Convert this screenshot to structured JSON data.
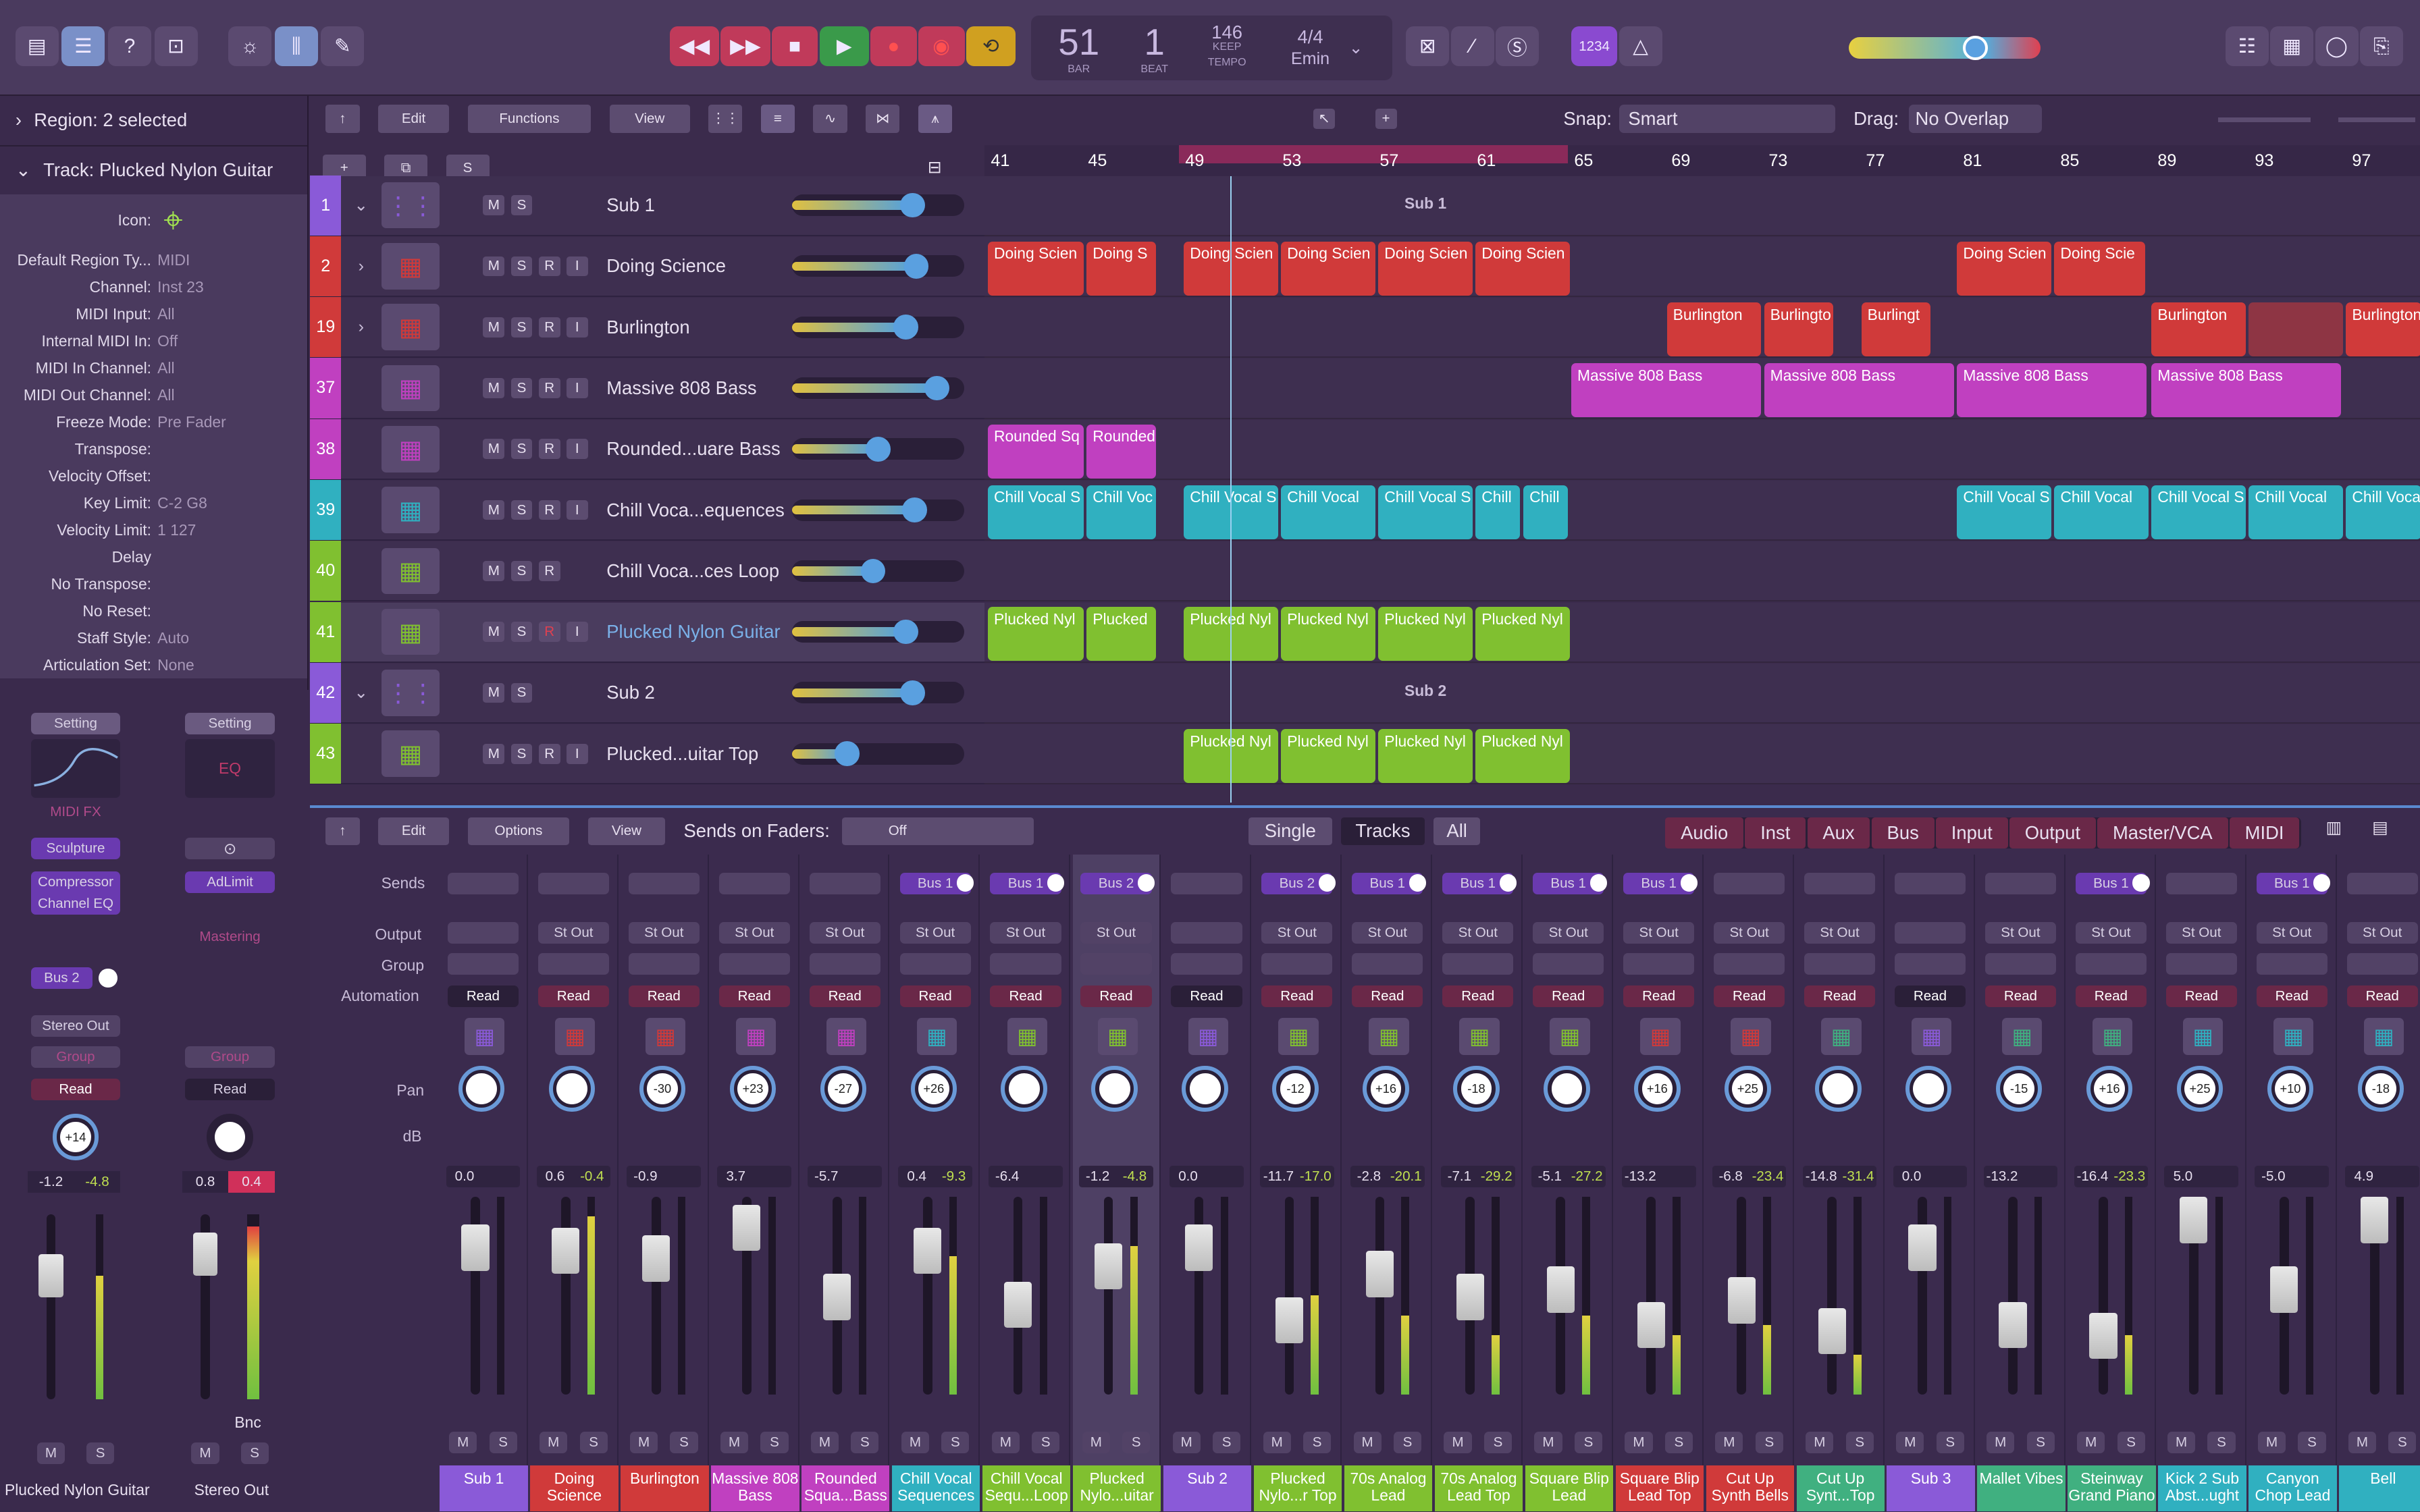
{
  "lcd": {
    "bar": "51",
    "beat": "1",
    "bar_lbl": "BAR",
    "beat_lbl": "BEAT",
    "tempo": "146",
    "keep": "KEEP",
    "tempo_lbl": "TEMPO",
    "sig": "4/4",
    "key": "Emin"
  },
  "countin": "1234",
  "inspector": {
    "region": "Region: 2 selected",
    "track": "Track:  Plucked Nylon Guitar",
    "icon_lbl": "Icon:",
    "rows": [
      [
        "Default Region Ty...",
        "MIDI"
      ],
      [
        "Channel:",
        "Inst 23"
      ],
      [
        "MIDI Input:",
        "All"
      ],
      [
        "Internal MIDI In:",
        "Off"
      ],
      [
        "MIDI In Channel:",
        "All"
      ],
      [
        "MIDI Out Channel:",
        "All"
      ],
      [
        "Freeze Mode:",
        "Pre Fader"
      ],
      [
        "Transpose:",
        ""
      ],
      [
        "Velocity Offset:",
        ""
      ],
      [
        "Key Limit:",
        "C-2  G8"
      ],
      [
        "Velocity Limit:",
        "1  127"
      ],
      [
        "Delay",
        ""
      ],
      [
        "No Transpose:",
        ""
      ],
      [
        "No Reset:",
        ""
      ],
      [
        "Staff Style:",
        "Auto"
      ],
      [
        "Articulation Set:",
        "None"
      ]
    ],
    "s1": {
      "setting": "Setting",
      "midifx": "MIDI FX",
      "inst": "Sculpture",
      "fx1": "Compressor",
      "fx2": "Channel EQ",
      "bus": "Bus 2",
      "out": "Stereo Out",
      "group": "Group",
      "read": "Read",
      "pan": "+14",
      "db1": "-1.2",
      "db2": "-4.8",
      "m": "M",
      "s": "S",
      "name": "Plucked Nylon Guitar"
    },
    "s2": {
      "setting": "Setting",
      "eq": "EQ",
      "fx1": "AdLimit",
      "mastering": "Mastering",
      "group": "Group",
      "read": "Read",
      "db1": "0.8",
      "db2": "0.4",
      "bnc": "Bnc",
      "m": "M",
      "s": "S",
      "name": "Stereo Out"
    }
  },
  "arr_menu": {
    "edit": "Edit",
    "functions": "Functions",
    "view": "View",
    "snap_lbl": "Snap:",
    "snap": "Smart",
    "drag_lbl": "Drag:",
    "drag": "No Overlap",
    "s": "S"
  },
  "ruler": [
    "41",
    "45",
    "49",
    "53",
    "57",
    "61",
    "65",
    "69",
    "73",
    "77",
    "81",
    "85",
    "89",
    "93",
    "97"
  ],
  "tracks": [
    {
      "num": "1",
      "name": "Sub 1",
      "col": "#8a5ad8",
      "fold": true,
      "btns": [
        "M",
        "S"
      ],
      "knob": 0.7,
      "lanelabel": "Sub 1"
    },
    {
      "num": "2",
      "name": "Doing Science",
      "col": "#d03a3a",
      "disc": true,
      "btns": [
        "M",
        "S",
        "R",
        "I"
      ],
      "knob": 0.72
    },
    {
      "num": "19",
      "name": "Burlington",
      "col": "#d03a3a",
      "disc": true,
      "btns": [
        "M",
        "S",
        "R",
        "I"
      ],
      "knob": 0.66
    },
    {
      "num": "37",
      "name": "Massive 808 Bass",
      "col": "#c040c0",
      "btns": [
        "M",
        "S",
        "R",
        "I"
      ],
      "knob": 0.84
    },
    {
      "num": "38",
      "name": "Rounded...uare Bass",
      "col": "#c040c0",
      "btns": [
        "M",
        "S",
        "R",
        "I"
      ],
      "knob": 0.5
    },
    {
      "num": "39",
      "name": "Chill Voca...equences",
      "col": "#30b0c0",
      "btns": [
        "M",
        "S",
        "R",
        "I"
      ],
      "knob": 0.71
    },
    {
      "num": "40",
      "name": "Chill Voca...ces Loop",
      "col": "#80c030",
      "btns": [
        "M",
        "S",
        "R"
      ],
      "knob": 0.47
    },
    {
      "num": "41",
      "name": "Plucked Nylon Guitar",
      "col": "#80c030",
      "btns": [
        "M",
        "S",
        "R",
        "I"
      ],
      "knob": 0.66
    },
    {
      "num": "42",
      "name": "Sub 2",
      "col": "#8a5ad8",
      "fold": true,
      "btns": [
        "M",
        "S"
      ],
      "knob": 0.7,
      "lanelabel": "Sub 2"
    },
    {
      "num": "43",
      "name": "Plucked...uitar Top",
      "col": "#80c030",
      "btns": [
        "M",
        "S",
        "R",
        "I"
      ],
      "knob": 0.32
    }
  ],
  "regions": [
    [],
    [
      [
        "Doing Scien",
        0,
        63
      ],
      [
        "Doing S",
        64,
        46
      ],
      [
        "Doing Scien",
        127,
        62
      ],
      [
        "Doing Scien",
        190,
        62
      ],
      [
        "Doing Scien",
        253,
        62
      ],
      [
        "Doing Scien",
        316,
        62
      ],
      [
        "Doing Scien",
        628,
        62
      ],
      [
        "Doing Scie",
        691,
        60
      ]
    ],
    [
      [
        "Burlington",
        440,
        62
      ],
      [
        "Burlingto",
        503,
        46
      ],
      [
        "Burlingt",
        566,
        46
      ],
      [
        "Burlington",
        754,
        62
      ],
      [
        "",
        817,
        62
      ],
      [
        "Burlington",
        880,
        50
      ]
    ],
    [
      [
        "Massive 808 Bass",
        378,
        124
      ],
      [
        "Massive 808 Bass",
        503,
        124
      ],
      [
        "Massive 808 Bass",
        628,
        124
      ],
      [
        "Massive 808 Bass",
        754,
        124
      ]
    ],
    [
      [
        "Rounded Sq",
        0,
        63
      ],
      [
        "Rounded",
        64,
        46
      ]
    ],
    [
      [
        "Chill Vocal S",
        0,
        63
      ],
      [
        "Chill Voc",
        64,
        46
      ],
      [
        "Chill Vocal S",
        127,
        62
      ],
      [
        "Chill Vocal",
        190,
        62
      ],
      [
        "Chill Vocal S",
        253,
        62
      ],
      [
        "Chill",
        316,
        30
      ],
      [
        "Chill",
        347,
        30
      ],
      [
        "Chill Vocal S",
        628,
        62
      ],
      [
        "Chill Vocal",
        691,
        62
      ],
      [
        "Chill Vocal S",
        754,
        62
      ],
      [
        "Chill Vocal",
        817,
        62
      ],
      [
        "Chill Vocal",
        880,
        50
      ]
    ],
    [],
    [
      [
        "Plucked Nyl",
        0,
        63
      ],
      [
        "Plucked",
        64,
        46
      ],
      [
        "Plucked Nyl",
        127,
        62
      ],
      [
        "Plucked Nyl",
        190,
        62
      ],
      [
        "Plucked Nyl",
        253,
        62
      ],
      [
        "Plucked Nyl",
        316,
        62
      ]
    ],
    [],
    [
      [
        "Plucked Nyl",
        127,
        62
      ],
      [
        "Plucked Nyl",
        190,
        62
      ],
      [
        "Plucked Nyl",
        253,
        62
      ],
      [
        "Plucked Nyl",
        316,
        62
      ]
    ]
  ],
  "mixer_menu": {
    "edit": "Edit",
    "options": "Options",
    "view": "View",
    "sends": "Sends on Faders:",
    "off": "Off",
    "single": "Single",
    "tracks": "Tracks",
    "all": "All",
    "filters": [
      "Audio",
      "Inst",
      "Aux",
      "Bus",
      "Input",
      "Output",
      "Master/VCA",
      "MIDI"
    ]
  },
  "row_labels": {
    "sends": "Sends",
    "output": "Output",
    "group": "Group",
    "automation": "Automation",
    "pan": "Pan",
    "db": "dB"
  },
  "strips": [
    {
      "name": "Sub 1",
      "col": "#8a5ad8",
      "send": "",
      "out": "",
      "auto": "Read",
      "pan": "",
      "db1": "0.0",
      "db2": "",
      "cap": 18,
      "meter": 0
    },
    {
      "name": "Doing Science",
      "col": "#d03a3a",
      "send": "",
      "out": "St Out",
      "auto": "Read",
      "pan": "",
      "db1": "0.6",
      "db2": "-0.4",
      "cap": 20,
      "meter": 0.9
    },
    {
      "name": "Burlington",
      "col": "#d03a3a",
      "send": "",
      "out": "St Out",
      "auto": "Read",
      "pan": "-30",
      "db1": "-0.9",
      "db2": "",
      "cap": 25,
      "meter": 0
    },
    {
      "name": "Massive 808 Bass",
      "col": "#c040c0",
      "send": "",
      "out": "St Out",
      "auto": "Read",
      "pan": "+23",
      "db1": "3.7",
      "db2": "",
      "cap": 5,
      "meter": 0
    },
    {
      "name": "Rounded Squa...Bass",
      "col": "#c040c0",
      "send": "",
      "out": "St Out",
      "auto": "Read",
      "pan": "-27",
      "db1": "-5.7",
      "db2": "",
      "cap": 50,
      "meter": 0
    },
    {
      "name": "Chill Vocal Sequences",
      "col": "#30b0c0",
      "send": "Bus 1",
      "out": "St Out",
      "auto": "Read",
      "pan": "+26",
      "db1": "0.4",
      "db2": "-9.3",
      "cap": 20,
      "meter": 0.7
    },
    {
      "name": "Chill Vocal Sequ...Loop",
      "col": "#80c030",
      "send": "Bus 1",
      "out": "St Out",
      "auto": "Read",
      "pan": "",
      "db1": "-6.4",
      "db2": "",
      "cap": 55,
      "meter": 0
    },
    {
      "name": "Plucked Nylo...uitar",
      "col": "#80c030",
      "send": "Bus 2",
      "out": "St Out",
      "auto": "Read",
      "pan": "",
      "db1": "-1.2",
      "db2": "-4.8",
      "cap": 30,
      "meter": 0.75
    },
    {
      "name": "Sub 2",
      "col": "#8a5ad8",
      "send": "",
      "out": "",
      "auto": "Read",
      "pan": "",
      "db1": "0.0",
      "db2": "",
      "cap": 18,
      "meter": 0
    },
    {
      "name": "Plucked Nylo...r Top",
      "col": "#80c030",
      "send": "Bus 2",
      "out": "St Out",
      "auto": "Read",
      "pan": "-12",
      "db1": "-11.7",
      "db2": "-17.0",
      "cap": 65,
      "meter": 0.5
    },
    {
      "name": "70s Analog Lead",
      "col": "#80c030",
      "send": "Bus 1",
      "out": "St Out",
      "auto": "Read",
      "pan": "+16",
      "db1": "-2.8",
      "db2": "-20.1",
      "cap": 35,
      "meter": 0.4
    },
    {
      "name": "70s Analog Lead Top",
      "col": "#80c030",
      "send": "Bus 1",
      "out": "St Out",
      "auto": "Read",
      "pan": "-18",
      "db1": "-7.1",
      "db2": "-29.2",
      "cap": 50,
      "meter": 0.3
    },
    {
      "name": "Square Blip Lead",
      "col": "#80c030",
      "send": "Bus 1",
      "out": "St Out",
      "auto": "Read",
      "pan": "",
      "db1": "-5.1",
      "db2": "-27.2",
      "cap": 45,
      "meter": 0.4
    },
    {
      "name": "Square Blip Lead Top",
      "col": "#d03a3a",
      "send": "Bus 1",
      "out": "St Out",
      "auto": "Read",
      "pan": "+16",
      "db1": "-13.2",
      "db2": "",
      "cap": 68,
      "meter": 0.3
    },
    {
      "name": "Cut Up Synth Bells",
      "col": "#d03a3a",
      "send": "",
      "out": "St Out",
      "auto": "Read",
      "pan": "+25",
      "db1": "-6.8",
      "db2": "-23.4",
      "cap": 52,
      "meter": 0.35
    },
    {
      "name": "Cut Up Synt...Top",
      "col": "#40b080",
      "send": "",
      "out": "St Out",
      "auto": "Read",
      "pan": "",
      "db1": "-14.8",
      "db2": "-31.4",
      "cap": 72,
      "meter": 0.2
    },
    {
      "name": "Sub 3",
      "col": "#8a5ad8",
      "send": "",
      "out": "",
      "auto": "Read",
      "pan": "",
      "db1": "0.0",
      "db2": "",
      "cap": 18,
      "meter": 0
    },
    {
      "name": "Mallet Vibes",
      "col": "#40b080",
      "send": "",
      "out": "St Out",
      "auto": "Read",
      "pan": "-15",
      "db1": "-13.2",
      "db2": "",
      "cap": 68,
      "meter": 0
    },
    {
      "name": "Steinway Grand Piano",
      "col": "#40b080",
      "send": "Bus 1",
      "out": "St Out",
      "auto": "Read",
      "pan": "+16",
      "db1": "-16.4",
      "db2": "-23.3",
      "cap": 75,
      "meter": 0.3
    },
    {
      "name": "Kick 2 Sub Abst...ught",
      "col": "#30b0c0",
      "send": "",
      "out": "St Out",
      "auto": "Read",
      "pan": "+25",
      "db1": "5.0",
      "db2": "",
      "cap": 0,
      "meter": 0
    },
    {
      "name": "Canyon Chop Lead",
      "col": "#30b0c0",
      "send": "Bus 1",
      "out": "St Out",
      "auto": "Read",
      "pan": "+10",
      "db1": "-5.0",
      "db2": "",
      "cap": 45,
      "meter": 0
    },
    {
      "name": "Bell",
      "col": "#30b0c0",
      "send": "",
      "out": "St Out",
      "auto": "Read",
      "pan": "-18",
      "db1": "4.9",
      "db2": "",
      "cap": 0,
      "meter": 0
    }
  ]
}
